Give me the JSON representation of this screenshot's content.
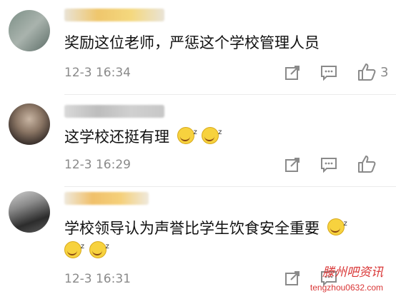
{
  "comments": [
    {
      "text": "奖励这位老师，严惩这个学校管理人员",
      "timestamp": "12-3 16:34",
      "like_count": "3",
      "share_icon": "share-icon",
      "comment_icon": "comment-icon",
      "like_icon": "thumb-up-icon"
    },
    {
      "text": "这学校还挺有理",
      "timestamp": "12-3 16:29",
      "like_count": "",
      "share_icon": "share-icon",
      "comment_icon": "comment-icon",
      "like_icon": "thumb-up-icon"
    },
    {
      "text": "学校领导认为声誉比学生饮食安全重要",
      "timestamp": "12-3 16:31",
      "like_count": "",
      "share_icon": "share-icon",
      "comment_icon": "comment-icon",
      "like_icon": "thumb-up-icon"
    }
  ],
  "watermark": {
    "title": "滕州吧资讯",
    "site": "tengzhou0632.com"
  },
  "colors": {
    "text": "#111111",
    "muted": "#8a8a8a",
    "watermark": "#d93535"
  }
}
